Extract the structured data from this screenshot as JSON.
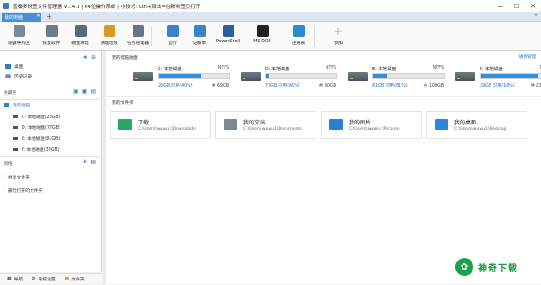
{
  "app": {
    "title": "蓝奏多标签文件管理器 V1.4.3 | 64位操作系统 | 小技巧: Ctrl+双击=在新标签页打开",
    "window_controls": [
      "—",
      "☐",
      "✕"
    ]
  },
  "tabs": [
    {
      "label": "我的电脑"
    }
  ],
  "tab_add": "+",
  "tab_close": "✕",
  "tab_menu": "▾",
  "toolbar": [
    {
      "icon": "layout-icon",
      "label": "隐藏导航区",
      "color": "#7a8a99"
    },
    {
      "icon": "recycle-bin-icon",
      "label": "恢复软件",
      "color": "#6e7a85"
    },
    {
      "icon": "disk-cleanup-icon",
      "label": "磁盘清理",
      "color": "#5d6b78"
    },
    {
      "icon": "broom-icon",
      "label": "清理垃圾",
      "color": "#d89a2b"
    },
    {
      "icon": "task-manager-icon",
      "label": "任务管理器",
      "color": "#6a7480"
    },
    {
      "icon": "run-icon",
      "label": "运行",
      "color": "#3f7fcf"
    },
    {
      "icon": "notepad-icon",
      "label": "记事本",
      "color": "#3b82c7"
    },
    {
      "icon": "powershell-icon",
      "label": "PowerShell",
      "color": "#2f5e9e"
    },
    {
      "icon": "msdos-icon",
      "label": "MS-DOS",
      "color": "#222"
    },
    {
      "icon": "registry-icon",
      "label": "注册表",
      "color": "#2d8ccf"
    },
    {
      "icon": "add-icon",
      "label": "添加",
      "color": "#aaaaaa"
    }
  ],
  "sidebar": {
    "quick_access": [
      {
        "label": "桌面",
        "icon": "desktop-icon"
      },
      {
        "label": "历史记录",
        "icon": "history-icon"
      }
    ],
    "favorites_title": "收藏夹",
    "computer": {
      "label": "我的电脑",
      "drives": [
        {
          "label": "C: 本地磁盘(28GB)"
        },
        {
          "label": "D: 本地磁盘(77GB)"
        },
        {
          "label": "E: 本地磁盘(81GB)"
        },
        {
          "label": "F: 本地磁盘(39GB)"
        }
      ]
    },
    "network": "网络",
    "shared": "共享文件夹",
    "recent_closed": "最近打开的文件夹",
    "bottom_tabs": [
      {
        "label": "导航",
        "icon": "nav-icon"
      },
      {
        "label": "系统设置",
        "icon": "gear-icon"
      },
      {
        "label": "文件夹",
        "icon": "folder-icon"
      }
    ]
  },
  "main": {
    "drives_title": "我的电脑磁盘",
    "manage_label": "磁盘管理",
    "drives": [
      {
        "name": "C: 本地磁盘",
        "fs": "NTFS",
        "free": "28GB 可用(40%)",
        "total": "共 69GB",
        "used_fraction": 0.6
      },
      {
        "name": "D: 本地磁盘",
        "fs": "NTFS",
        "free": "77GB 可用(96%)",
        "total": "共 80GB",
        "used_fraction": 0.04
      },
      {
        "name": "E: 本地磁盘",
        "fs": "NTFS",
        "free": "81GB 可用(81%)",
        "total": "共 100GB",
        "used_fraction": 0.19
      },
      {
        "name": "F: 本地磁盘",
        "fs": "NTFS",
        "free": "39GB 可用(18%)",
        "total": "共 215GB",
        "used_fraction": 0.82
      }
    ],
    "folders_title": "我的文件夹",
    "folders": [
      {
        "name": "下载",
        "path": "C:\\Users\\wuwu1\\Downloads",
        "icon": "download-folder-icon",
        "color": "#2aa56a"
      },
      {
        "name": "我的文档",
        "path": "C:\\Users\\wuwu1\\Documents",
        "icon": "documents-folder-icon",
        "color": "#7a8794"
      },
      {
        "name": "我的图片",
        "path": "C:\\Users\\wuwu1\\Pictures",
        "icon": "pictures-folder-icon",
        "color": "#2f7fd0"
      },
      {
        "name": "我的桌面",
        "path": "C:\\Users\\wuwu1\\Desktop",
        "icon": "desktop-folder-icon",
        "color": "#2e86d6"
      }
    ]
  },
  "watermark": "神奇下载"
}
